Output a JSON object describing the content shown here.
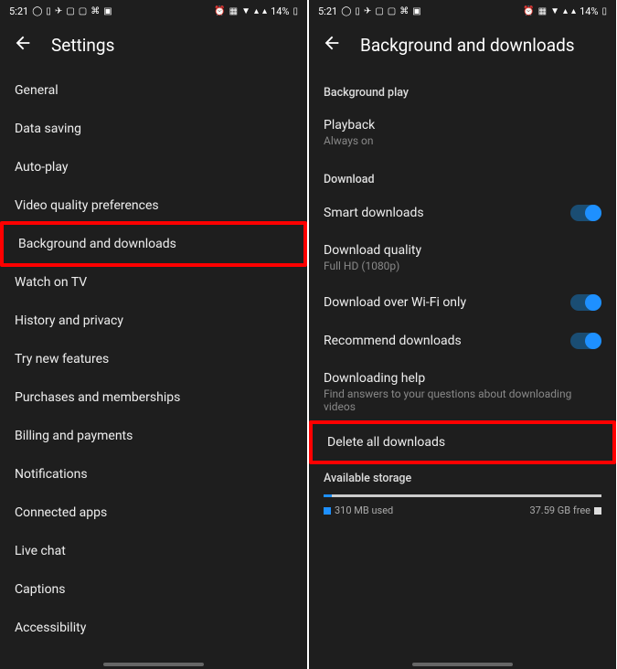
{
  "status": {
    "time": "5:21",
    "battery": "14%"
  },
  "left": {
    "title": "Settings",
    "items": [
      "General",
      "Data saving",
      "Auto-play",
      "Video quality preferences",
      "Background and downloads",
      "Watch on TV",
      "History and privacy",
      "Try new features",
      "Purchases and memberships",
      "Billing and payments",
      "Notifications",
      "Connected apps",
      "Live chat",
      "Captions",
      "Accessibility"
    ]
  },
  "right": {
    "title": "Background and downloads",
    "sections": {
      "bg_play": "Background play",
      "download": "Download"
    },
    "playback": {
      "title": "Playback",
      "subtitle": "Always on"
    },
    "smart_downloads": "Smart downloads",
    "download_quality": {
      "title": "Download quality",
      "subtitle": "Full HD (1080p)"
    },
    "wifi_only": "Download over Wi-Fi only",
    "recommend": "Recommend downloads",
    "help": {
      "title": "Downloading help",
      "subtitle": "Find answers to your questions about downloading videos"
    },
    "delete_all": "Delete all downloads",
    "storage": {
      "title": "Available storage",
      "used": "310 MB used",
      "free": "37.59 GB free"
    }
  }
}
